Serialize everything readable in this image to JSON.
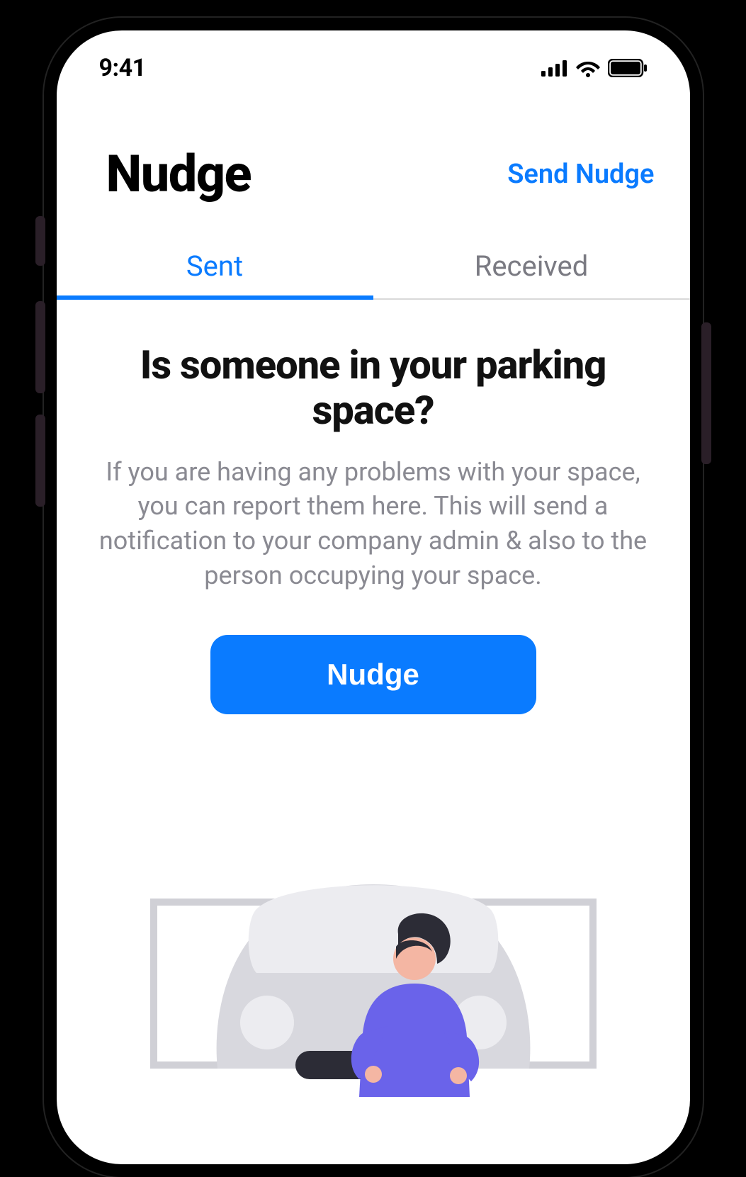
{
  "status_bar": {
    "time": "9:41"
  },
  "header": {
    "title": "Nudge",
    "action": "Send Nudge"
  },
  "tabs": {
    "sent": "Sent",
    "received": "Received"
  },
  "content": {
    "heading": "Is someone in your parking space?",
    "body": "If you are having any problems with your space, you can report them here. This will send a notification to your company admin & also to the person occupying your space.",
    "button": "Nudge"
  }
}
